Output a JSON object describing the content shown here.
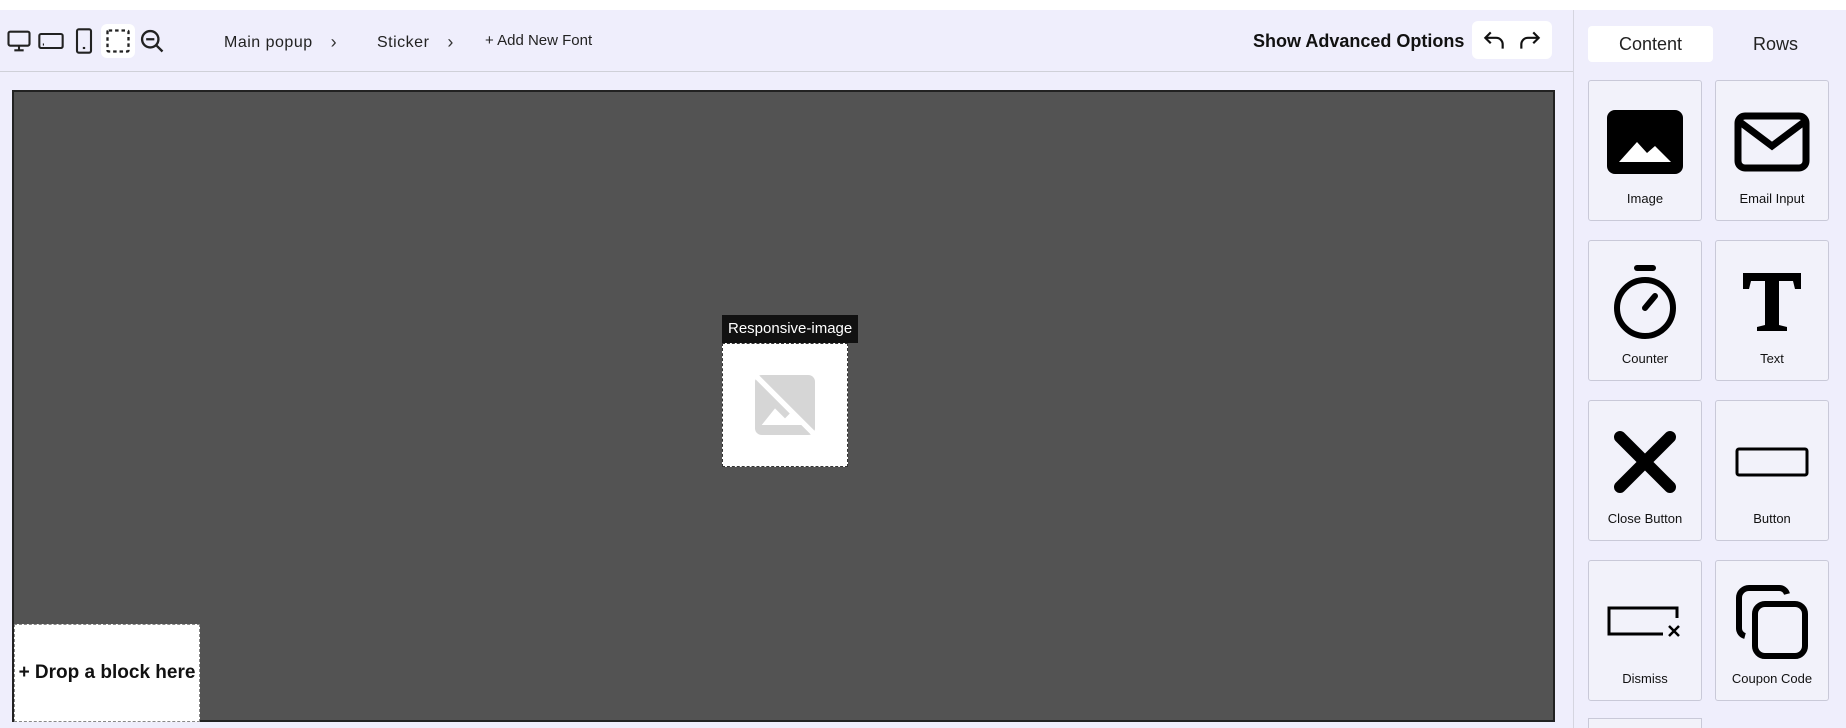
{
  "toolbar": {
    "breadcrumbs": [
      "Main popup",
      "Sticker"
    ],
    "add_font": "+ Add New Font",
    "advanced": "Show Advanced Options"
  },
  "canvas": {
    "selected_label": "Responsive-image",
    "drop_zone": "+ Drop a block here"
  },
  "panel": {
    "tabs": [
      "Content",
      "Rows"
    ],
    "blocks": [
      {
        "label": "Image",
        "icon": "image-icon"
      },
      {
        "label": "Email Input",
        "icon": "envelope-icon"
      },
      {
        "label": "Counter",
        "icon": "stopwatch-icon"
      },
      {
        "label": "Text",
        "icon": "text-t-icon"
      },
      {
        "label": "Close Button",
        "icon": "close-x-icon"
      },
      {
        "label": "Button",
        "icon": "button-rectangle-icon"
      },
      {
        "label": "Dismiss",
        "icon": "dismiss-icon"
      },
      {
        "label": "Coupon Code",
        "icon": "copy-icon"
      }
    ]
  }
}
